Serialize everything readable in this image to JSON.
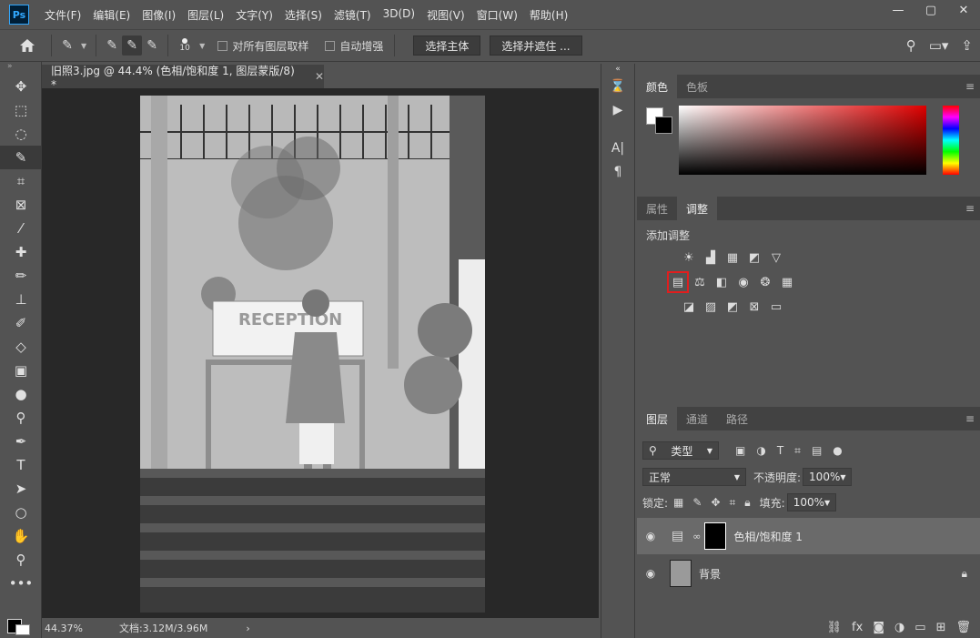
{
  "app": {
    "logo": "Ps"
  },
  "menu": [
    "文件(F)",
    "编辑(E)",
    "图像(I)",
    "图层(L)",
    "文字(Y)",
    "选择(S)",
    "滤镜(T)",
    "3D(D)",
    "视图(V)",
    "窗口(W)",
    "帮助(H)"
  ],
  "window_controls": [
    "—",
    "▢",
    "✕"
  ],
  "options": {
    "brush_size": "10",
    "sample_all_layers": "对所有图层取样",
    "auto_enhance": "自动增强",
    "select_subject": "选择主体",
    "select_and_mask": "选择并遮住 ..."
  },
  "document": {
    "tab_title": "旧照3.jpg @ 44.4% (色相/饱和度 1, 图层蒙版/8) *",
    "zoom": "44.37%",
    "doc_info": "文档:3.12M/3.96M",
    "sign_text": "RECEPTION"
  },
  "color_panel": {
    "tabs": [
      "颜色",
      "色板"
    ]
  },
  "adjust_panel": {
    "tabs": [
      "属性",
      "调整"
    ],
    "title": "添加调整"
  },
  "layers_panel": {
    "tabs": [
      "图层",
      "通道",
      "路径"
    ],
    "filter_kind": "类型",
    "blend_mode": "正常",
    "opacity_label": "不透明度:",
    "opacity": "100%",
    "lock_label": "锁定:",
    "fill_label": "填充:",
    "fill": "100%",
    "layers": [
      {
        "name": "色相/饱和度 1"
      },
      {
        "name": "背景"
      }
    ]
  }
}
